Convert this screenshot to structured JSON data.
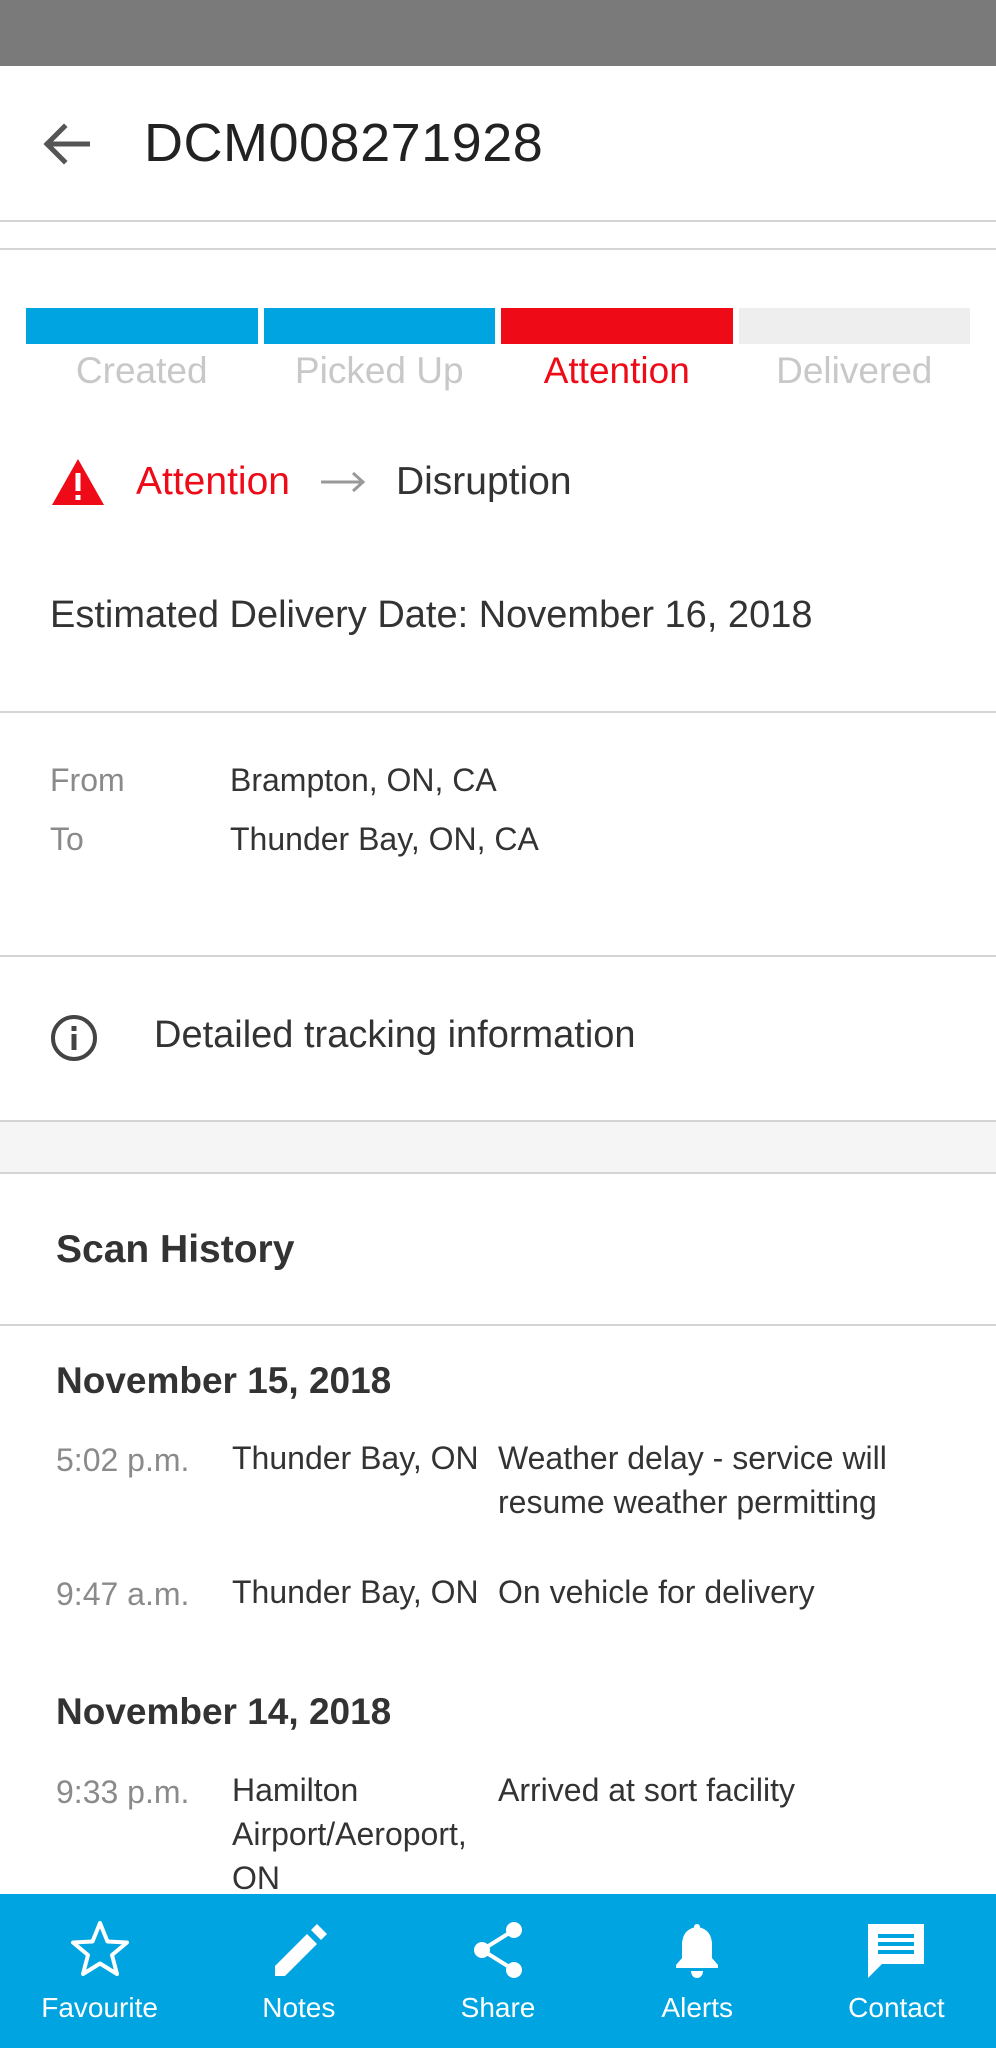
{
  "header": {
    "title": "DCM008271928",
    "back_icon": "arrow-left-icon"
  },
  "progress": {
    "steps": [
      {
        "label": "Created",
        "color": "#00a4e0",
        "active": false
      },
      {
        "label": "Picked Up",
        "color": "#00a4e0",
        "active": false
      },
      {
        "label": "Attention",
        "color": "#ee0a17",
        "active": true
      },
      {
        "label": "Delivered",
        "color": "#eeeeee",
        "active": false
      }
    ],
    "completed_fraction": 0.75
  },
  "status": {
    "icon": "warning-icon",
    "label": "Attention",
    "detail": "Disruption",
    "alert_color": "#ee0a17"
  },
  "estimated_delivery": "Estimated Delivery Date: November 16, 2018",
  "route": {
    "from_label": "From",
    "from_value": "Brampton, ON, CA",
    "to_label": "To",
    "to_value": "Thunder Bay, ON, CA"
  },
  "detailed_tracking": {
    "icon": "info-icon",
    "label": "Detailed tracking information"
  },
  "scan_history": {
    "title": "Scan History",
    "days": [
      {
        "date": "November 15, 2018",
        "events": [
          {
            "time": "5:02 p.m.",
            "location": "Thunder Bay, ON",
            "description": "Weather delay - service will resume weather permitting"
          },
          {
            "time": "9:47 a.m.",
            "location": "Thunder Bay, ON",
            "description": "On vehicle for delivery"
          }
        ]
      },
      {
        "date": "November 14, 2018",
        "events": [
          {
            "time": "9:33 p.m.",
            "location": "Hamilton Airport/Aeroport, ON",
            "description": "Arrived at sort facility"
          }
        ]
      }
    ]
  },
  "bottom_nav": {
    "background": "#00a4e0",
    "items": [
      {
        "label": "Favourite",
        "icon": "star-icon"
      },
      {
        "label": "Notes",
        "icon": "pencil-icon"
      },
      {
        "label": "Share",
        "icon": "share-icon"
      },
      {
        "label": "Alerts",
        "icon": "bell-icon"
      },
      {
        "label": "Contact",
        "icon": "message-icon"
      }
    ]
  }
}
